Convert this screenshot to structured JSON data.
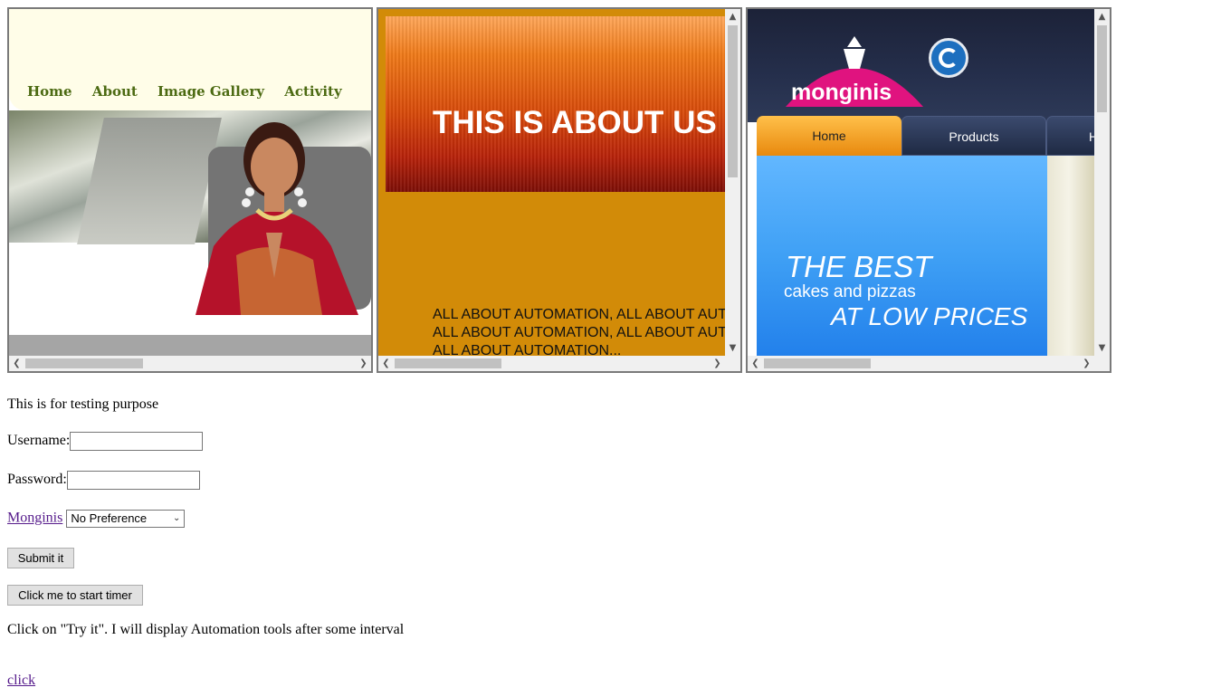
{
  "frame1": {
    "nav": [
      "Home",
      "About",
      "Image Gallery",
      "Activity"
    ]
  },
  "frame2": {
    "banner_title": "THIS IS ABOUT US P",
    "body_text": "ALL ABOUT AUTOMATION, ALL ABOUT AUTOMATION, ALL ABOUT AUTOMATION, ALL ABOUT AUTOMATION, ALL ABOUT AUTOMATION..."
  },
  "frame3": {
    "logo_text": "monginis",
    "tabs": [
      "Home",
      "Products",
      "H"
    ],
    "promo": {
      "line1": "THE BEST",
      "line2": "cakes and pizzas",
      "line3": "AT LOW PRICES"
    }
  },
  "page": {
    "testing_text": "This is for testing purpose",
    "username_label": "Username:",
    "username_value": "",
    "password_label": "Password:",
    "password_value": "",
    "monginis_link": "Monginis",
    "preference_selected": "No Preference",
    "submit_label": "Submit it",
    "timer_label": "Click me to start timer",
    "info_text": "Click on \"Try it\". I will display Automation tools after some interval",
    "click_link": "click"
  },
  "colors": {
    "nav_green": "#4c6a12",
    "frame2_bg": "#d28b08",
    "frame3_blue": "#3fa0f5",
    "link": "#551a8b"
  }
}
